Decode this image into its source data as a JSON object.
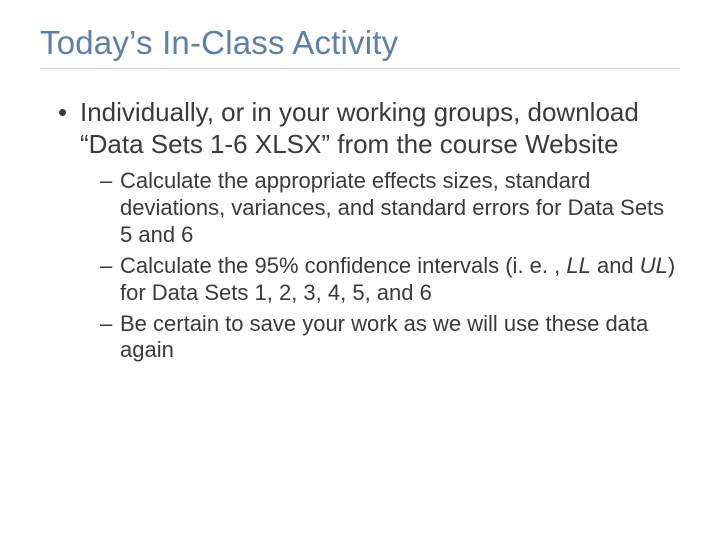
{
  "title": "Today’s In-Class Activity",
  "bullet1": {
    "text": "Individually, or in your working groups, download “Data Sets 1-6 XLSX” from the course Website",
    "sub": [
      "Calculate the appropriate effects sizes, standard deviations, variances, and standard errors for Data Sets 5 and 6",
      {
        "pre": "Calculate the 95% confidence intervals (i. e. , ",
        "ll": "LL",
        "mid": " and ",
        "ul": "UL",
        "post": ") for Data Sets 1, 2, 3, 4, 5, and 6"
      },
      "Be certain to save your work as we will use these data again"
    ]
  }
}
